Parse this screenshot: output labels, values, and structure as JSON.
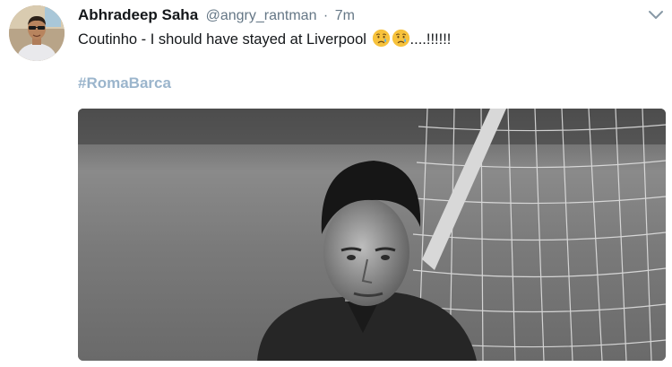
{
  "tweet": {
    "author_name": "Abhradeep Saha",
    "handle": "@angry_rantman",
    "separator": "·",
    "time": "7m",
    "text": "Coutinho - I should have stayed at Liverpool",
    "emojis": [
      "crying-face",
      "crying-face"
    ],
    "text_suffix": "....!!!!!!",
    "hashtag": "#RomaBarca"
  },
  "icons": {
    "menu": "chevron-down-icon",
    "emoji": "crying-face-emoji"
  },
  "colors": {
    "name": "#14171a",
    "meta": "#657786",
    "hashtag": "#9bb5cc",
    "emoji": "#f7c23c",
    "tear": "#5ab0e8"
  }
}
